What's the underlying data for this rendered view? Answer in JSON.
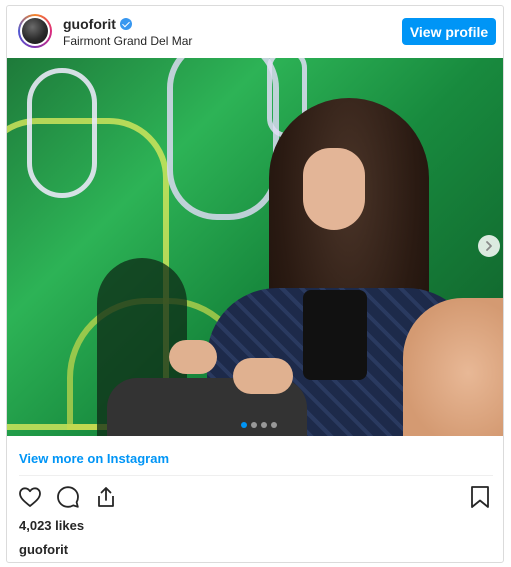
{
  "post": {
    "username": "guoforit",
    "location": "Fairmont Grand Del Mar",
    "view_profile_label": "View profile",
    "view_more_label": "View more on Instagram",
    "likes": "4,023 likes",
    "caption_username": "guoforit",
    "carousel": {
      "total": 4,
      "active": 1
    }
  },
  "icons": {
    "verified": "verified-badge-icon",
    "like": "heart-icon",
    "comment": "comment-bubble-icon",
    "share": "share-icon",
    "save": "bookmark-icon",
    "next": "chevron-right-icon"
  },
  "colors": {
    "accent": "#0095f6",
    "text": "#262626",
    "border": "#dbdbdb"
  }
}
